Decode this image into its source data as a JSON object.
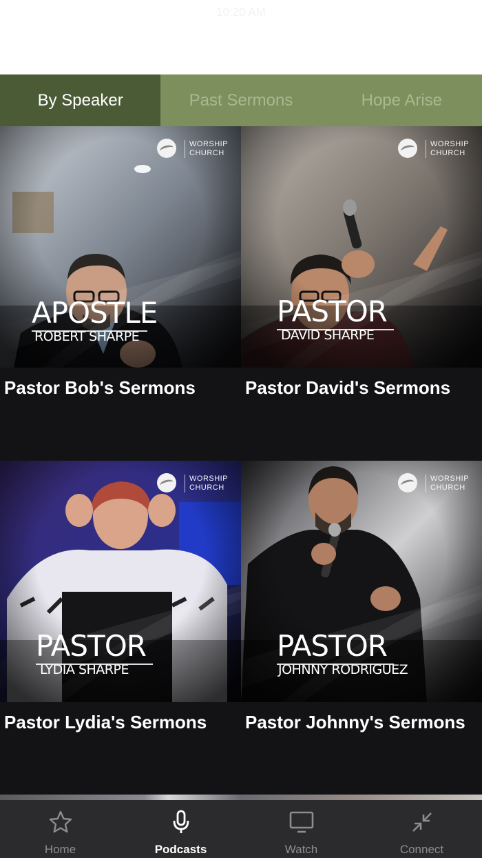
{
  "status_bar": {
    "time": "10:20 AM"
  },
  "tabs": [
    {
      "label": "By Speaker",
      "active": true
    },
    {
      "label": "Past Sermons",
      "active": false
    },
    {
      "label": "Hope Arise",
      "active": false
    }
  ],
  "logo": {
    "line1": "WORSHIP",
    "line2": "CHURCH"
  },
  "cards": [
    {
      "title": "Pastor Bob's Sermons",
      "role": "APOSTLE",
      "name": "ROBERT SHARPE"
    },
    {
      "title": "Pastor David's Sermons",
      "role": "PASTOR",
      "name": "DAVID SHARPE"
    },
    {
      "title": "Pastor Lydia's Sermons",
      "role": "PASTOR",
      "name": "LYDIA SHARPE"
    },
    {
      "title": "Pastor Johnny's Sermons",
      "role": "PASTOR",
      "name": "JOHNNY RODRIGUEZ"
    }
  ],
  "bottom_nav": [
    {
      "label": "Home",
      "icon": "star-icon",
      "active": false
    },
    {
      "label": "Podcasts",
      "icon": "microphone-icon",
      "active": true
    },
    {
      "label": "Watch",
      "icon": "monitor-icon",
      "active": false
    },
    {
      "label": "Connect",
      "icon": "collapse-arrows-icon",
      "active": false
    }
  ],
  "colors": {
    "tab_bar_bg": "#7c8f5d",
    "tab_active_bg": "#4a5b35",
    "tab_inactive_text": "#a9b98f",
    "page_bg": "#131315",
    "bottom_nav_bg": "#2b2b2d"
  }
}
